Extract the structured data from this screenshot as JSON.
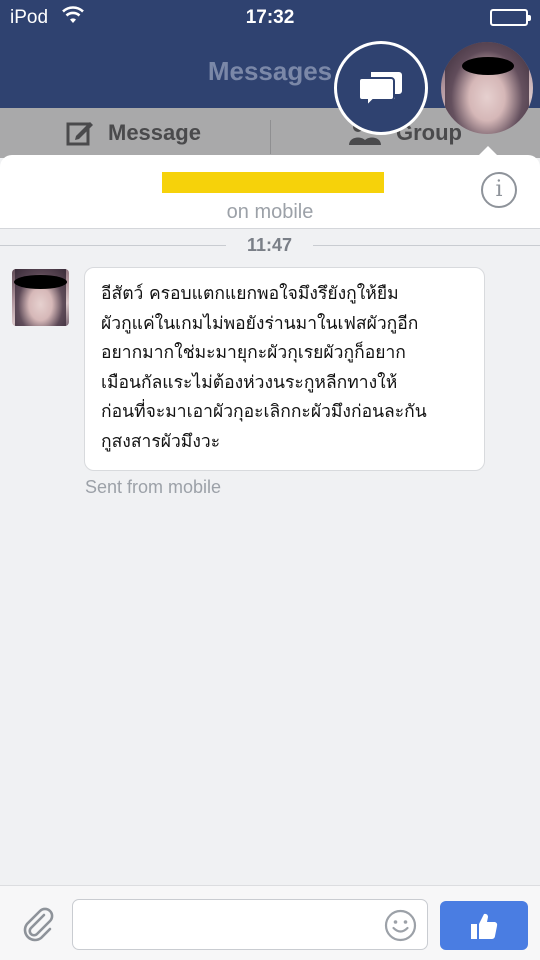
{
  "status_bar": {
    "carrier": "iPod",
    "time": "17:32"
  },
  "nav": {
    "title": "Messages",
    "message_button": "Message",
    "group_button": "Group"
  },
  "chat": {
    "subtitle": "on mobile",
    "timestamp": "11:47",
    "message_lines": [
      "อีสัตว์ ครอบแตกแยกพอใจมึงรึยังกูให้ยืม",
      "ผัวกูแค่ในเกมไม่พอยังร่านมาในเฟสผัวกูอีก",
      "อยากมากใช่มะมายุกะผัวกุเรยผัวกูก็อยาก",
      "เมือนกัลแระไม่ต้องห่วงนระกูหลีกทางให้",
      "ก่อนที่จะมาเอาผัวกุอะเลิกกะผัวมึงก่อนละกัน",
      "กูสงสารผัวมึงวะ"
    ],
    "sent_from": "Sent from mobile"
  },
  "composer": {
    "input_value": "",
    "input_placeholder": ""
  },
  "colors": {
    "nav_bg": "#2f4270",
    "like_button": "#4a7de2",
    "redaction": "#f6d20a"
  },
  "icons": [
    "wifi-icon",
    "battery-icon",
    "compose-icon",
    "group-icon",
    "chat-heads-icon",
    "info-icon",
    "paperclip-icon",
    "smiley-icon",
    "thumbs-up-icon"
  ]
}
